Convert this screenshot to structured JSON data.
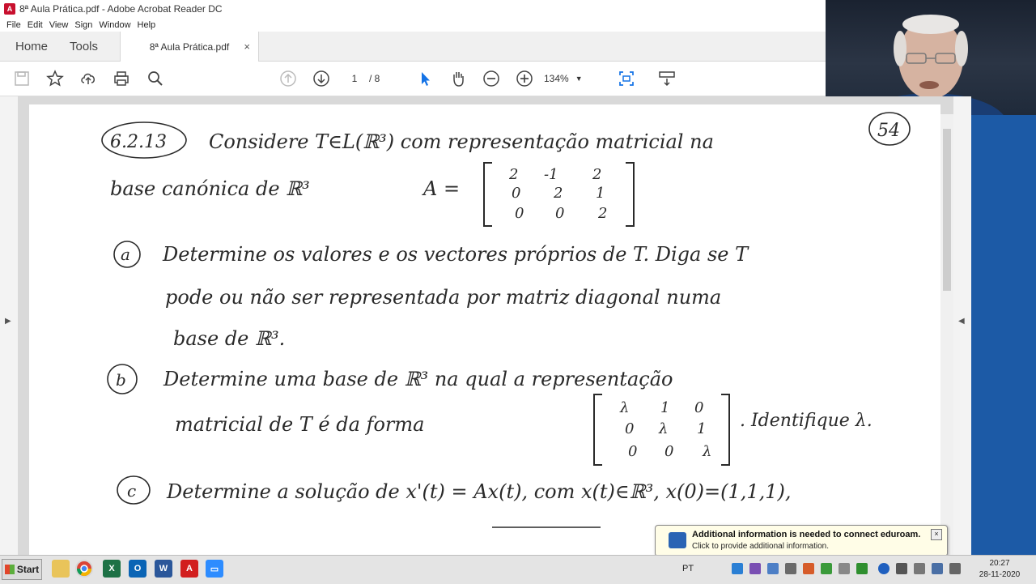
{
  "window": {
    "title": "8ª Aula Prática.pdf - Adobe Acrobat Reader DC"
  },
  "menu": [
    "File",
    "Edit",
    "View",
    "Sign",
    "Window",
    "Help"
  ],
  "tabs": {
    "home": "Home",
    "tools": "Tools",
    "document": "8ª Aula Prática.pdf",
    "close": "×"
  },
  "toolbar": {
    "page_current": "1",
    "page_total": "/ 8",
    "zoom": "134%"
  },
  "document": {
    "exercise": "6.2.13",
    "badge": "54",
    "line1": "Considere T∈L(ℝ³) com representação matricial na",
    "line2": "base canónica de ℝ³",
    "matrix_label": "A =",
    "matrix_A": [
      [
        "2",
        "-1",
        "2"
      ],
      [
        "0",
        "2",
        "1"
      ],
      [
        "0",
        "0",
        "2"
      ]
    ],
    "item_a_label": "a",
    "item_a_1": "Determine os valores e os vectores próprios de T. Diga se T",
    "item_a_2": "pode ou não ser representada por matriz diagonal numa",
    "item_a_3": "base de ℝ³.",
    "item_b_label": "b",
    "item_b_1": "Determine uma base de ℝ³ na qual a representação",
    "item_b_2": "matricial de T é da forma",
    "matrix_J": [
      [
        "λ",
        "1",
        "0"
      ],
      [
        "0",
        "λ",
        "1"
      ],
      [
        "0",
        "0",
        "λ"
      ]
    ],
    "item_b_3": ". Identifique λ.",
    "item_c_label": "c",
    "item_c_1": "Determine a solução de x'(t) = Ax(t), com x(t)∈ℝ³, x(0)=(1,1,1),"
  },
  "taskbar": {
    "start": "Start",
    "lang": "PT",
    "time": "20:27",
    "date": "28-11-2020"
  },
  "notification": {
    "title": "Additional information is needed to connect eduroam.",
    "subtitle": "Click to provide additional information.",
    "close": "×"
  }
}
